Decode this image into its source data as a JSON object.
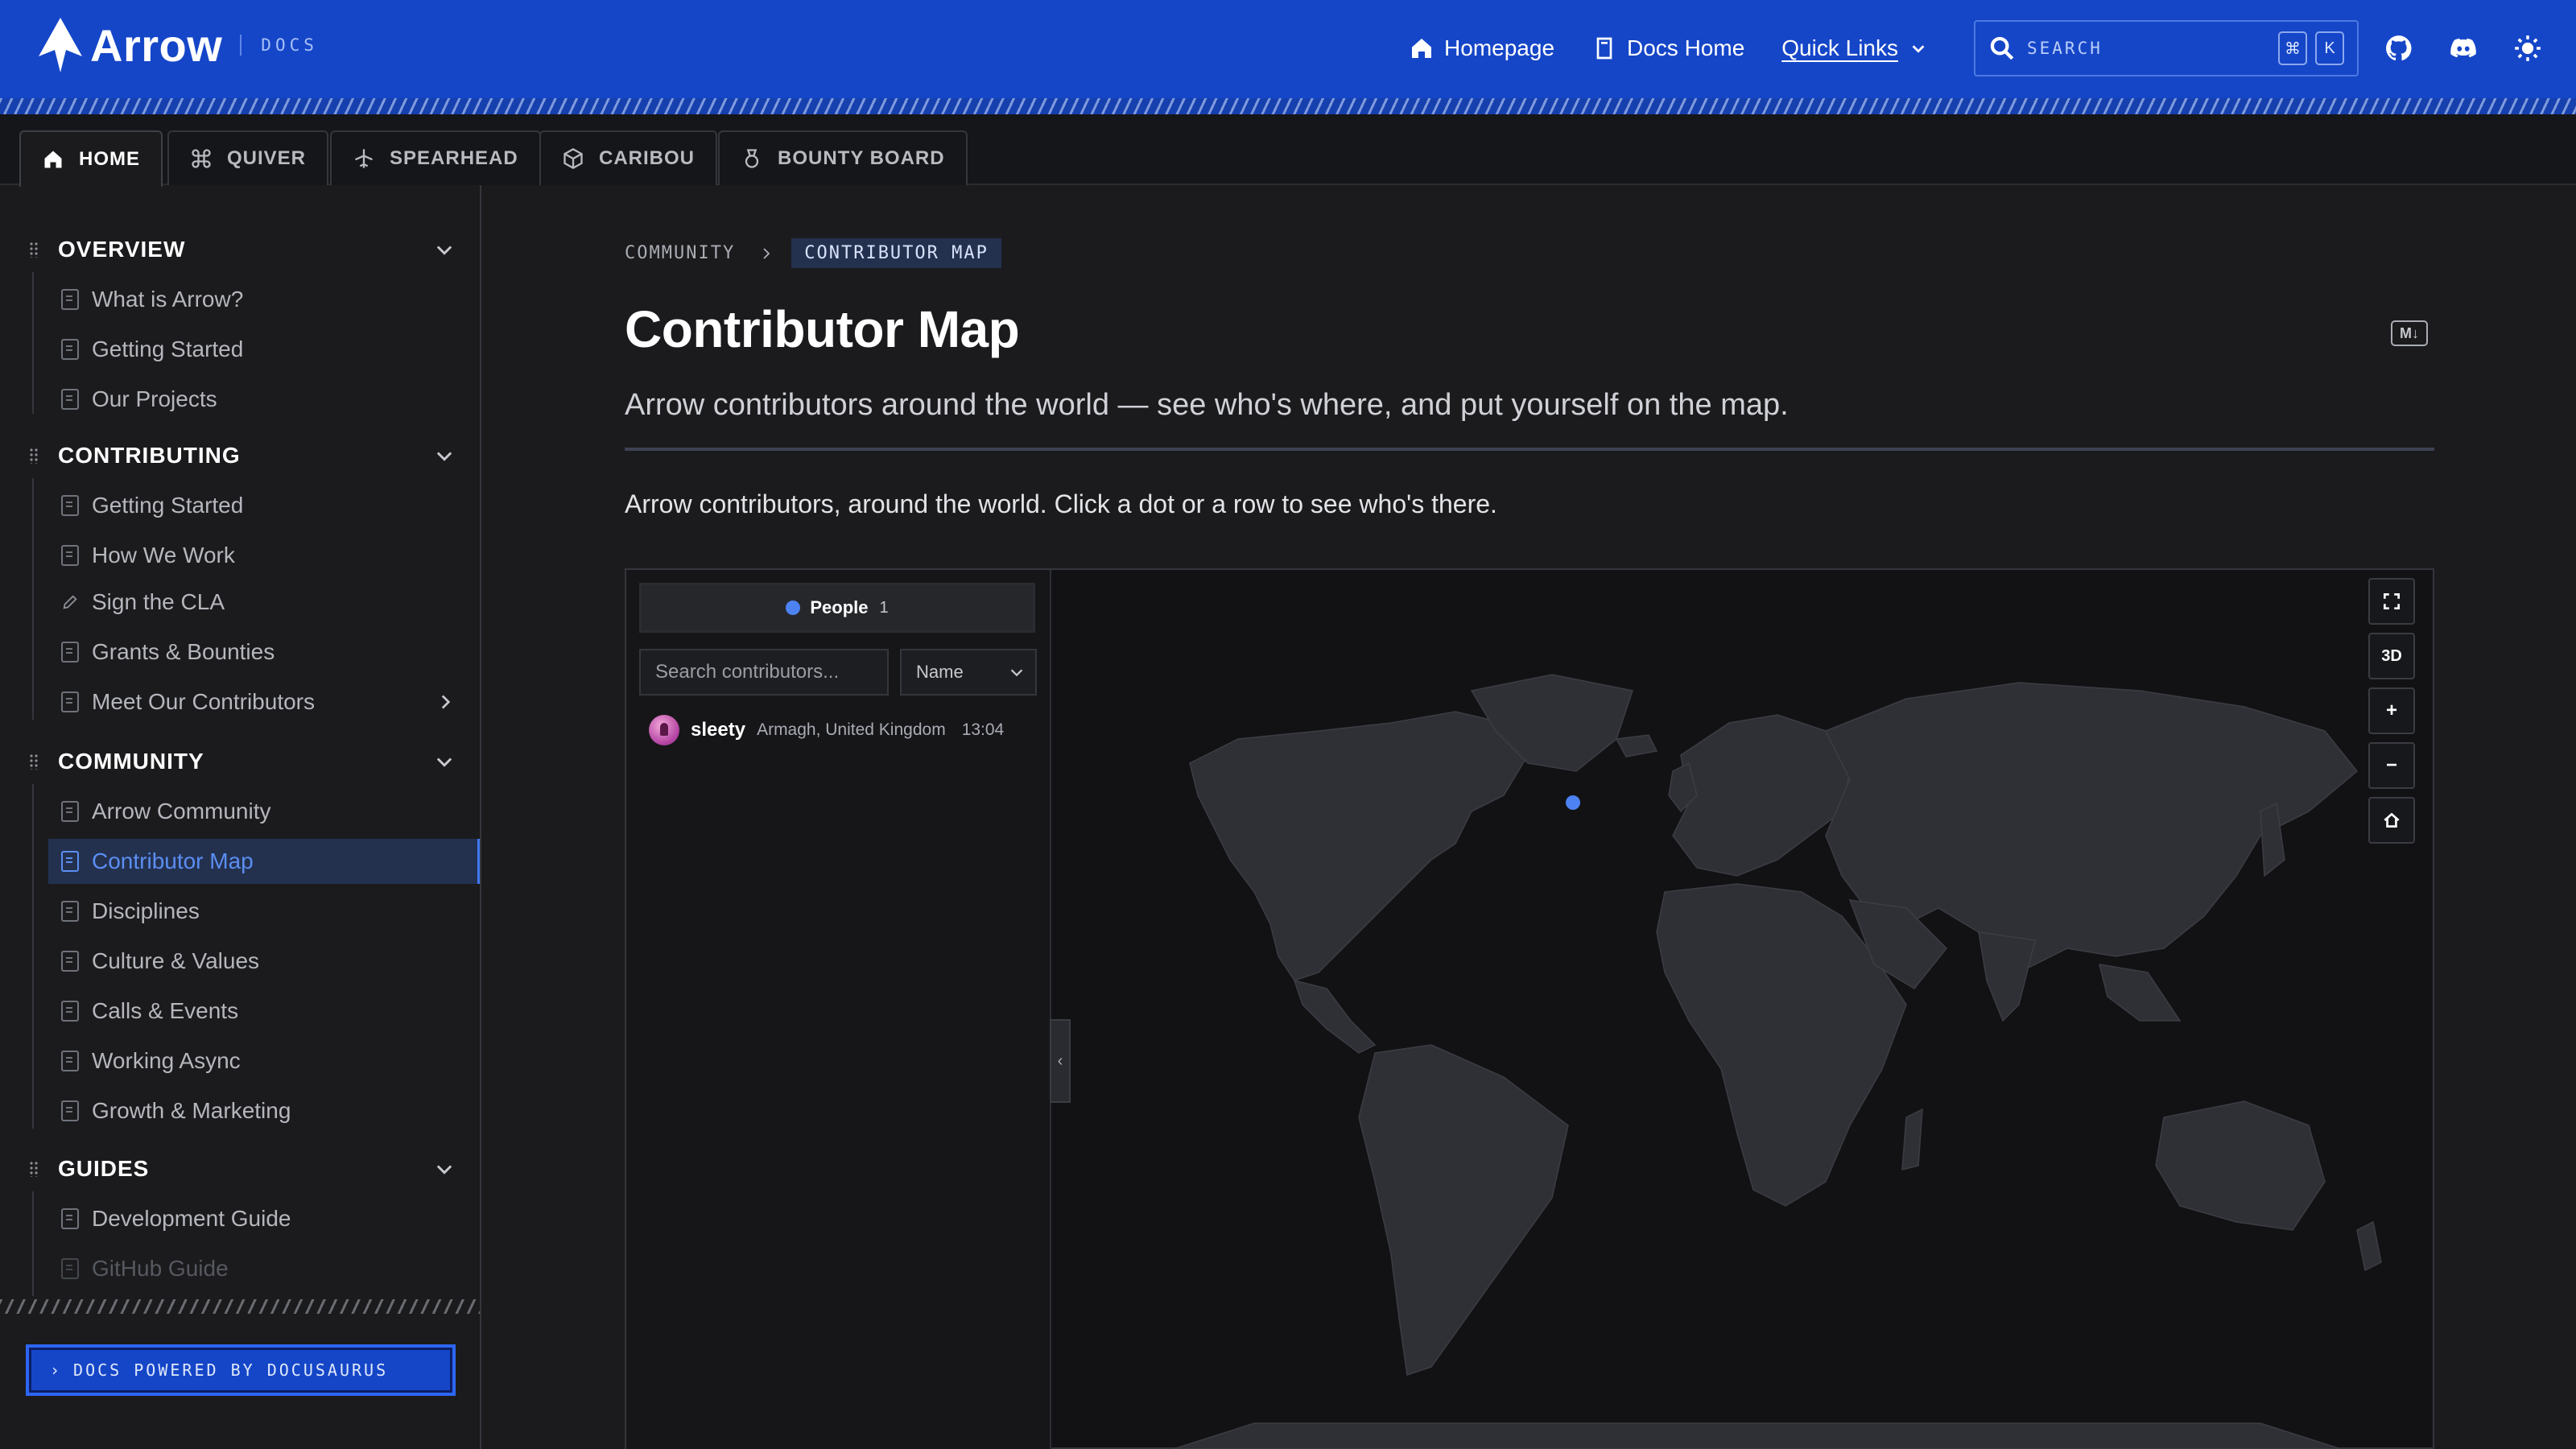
{
  "brand": {
    "name": "Arrow",
    "section": "DOCS"
  },
  "navbar": {
    "links": [
      {
        "label": "Homepage",
        "icon": "home-icon"
      },
      {
        "label": "Docs Home",
        "icon": "book-icon"
      },
      {
        "label": "Quick Links",
        "icon": "chevron-down-icon"
      }
    ],
    "search": {
      "placeholder": "SEARCH",
      "kbd": [
        "⌘",
        "K"
      ]
    },
    "icons": [
      "github-icon",
      "discord-icon",
      "sun-icon"
    ]
  },
  "tabs": [
    {
      "label": "HOME",
      "icon": "home-icon",
      "active": true
    },
    {
      "label": "QUIVER",
      "icon": "command-icon"
    },
    {
      "label": "SPEARHEAD",
      "icon": "airplane-icon"
    },
    {
      "label": "CARIBOU",
      "icon": "box-icon"
    },
    {
      "label": "BOUNTY BOARD",
      "icon": "medal-icon"
    }
  ],
  "sidebar": {
    "sections": [
      {
        "title": "OVERVIEW",
        "items": [
          "What is Arrow?",
          "Getting Started",
          "Our Projects"
        ]
      },
      {
        "title": "CONTRIBUTING",
        "items": [
          "Getting Started",
          "How We Work",
          "Sign the CLA",
          "Grants & Bounties",
          "Meet Our Contributors"
        ]
      },
      {
        "title": "COMMUNITY",
        "items": [
          "Arrow Community",
          "Contributor Map",
          "Disciplines",
          "Culture & Values",
          "Calls & Events",
          "Working Async",
          "Growth & Marketing"
        ]
      },
      {
        "title": "GUIDES",
        "items": [
          "Development Guide",
          "GitHub Guide"
        ]
      }
    ],
    "active_item": "Contributor Map",
    "footer": "DOCS POWERED BY DOCUSAURUS"
  },
  "breadcrumb": [
    "COMMUNITY",
    "CONTRIBUTOR MAP"
  ],
  "page": {
    "title": "Contributor Map",
    "md_icon": "M↓",
    "subtitle": "Arrow contributors around the world — see who's where, and put yourself on the map.",
    "intro": "Arrow contributors, around the world. Click a dot or a row to see who's there."
  },
  "map_panel": {
    "people_tab": {
      "label": "People",
      "count": "1"
    },
    "search_placeholder": "Search contributors...",
    "sort": "Name",
    "people": [
      {
        "name": "sleety",
        "location": "Armagh, United Kingdom",
        "time": "13:04"
      }
    ],
    "controls": [
      "fullscreen-icon",
      "3D",
      "+",
      "−",
      "home-icon"
    ],
    "collapse_glyph": "‹",
    "accent": "#4d82f3"
  }
}
